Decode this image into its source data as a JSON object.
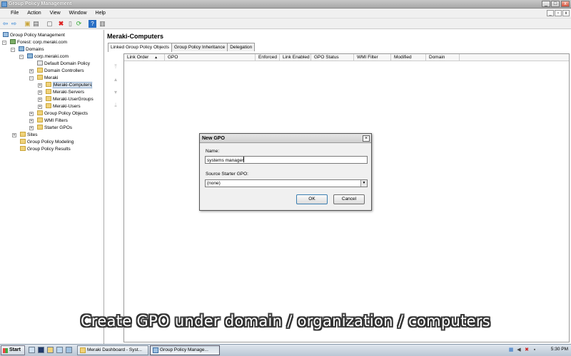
{
  "window": {
    "title": "Group Policy Management"
  },
  "menu": [
    "File",
    "Action",
    "View",
    "Window",
    "Help"
  ],
  "toolbar": {
    "buttons": [
      "back-icon",
      "forward-icon",
      "up-icon",
      "show-hide-tree-icon",
      "properties-icon",
      "delete-icon",
      "export-icon",
      "refresh-icon",
      "help-icon",
      "console-icon"
    ]
  },
  "tree": {
    "root": "Group Policy Management",
    "forest": "Forest: corp.meraki.com",
    "domains": "Domains",
    "domain": "corp.meraki.com",
    "default_policy": "Default Domain Policy",
    "domain_controllers": "Domain Controllers",
    "meraki": "Meraki",
    "meraki_computers": "Meraki-Computers",
    "meraki_servers": "Meraki-Servers",
    "meraki_usergroups": "Meraki-UserGroups",
    "meraki_users": "Meraki-Users",
    "gpo_objects": "Group Policy Objects",
    "wmi_filters": "WMI Filters",
    "starter_gpos": "Starter GPOs",
    "sites": "Sites",
    "modeling": "Group Policy Modeling",
    "results": "Group Policy Results"
  },
  "right": {
    "heading": "Meraki-Computers",
    "tabs": [
      "Linked Group Policy Objects",
      "Group Policy Inheritance",
      "Delegation"
    ],
    "columns": [
      "Link Order",
      "GPO",
      "Enforced",
      "Link Enabled",
      "GPO Status",
      "WMI Filter",
      "Modified",
      "Domain"
    ],
    "sort_glyph": "▲"
  },
  "dialog": {
    "title": "New GPO",
    "name_label": "Name:",
    "name_value": "systems manager",
    "starter_label": "Source Starter GPO:",
    "starter_value": "(none)",
    "ok_label": "OK",
    "cancel_label": "Cancel"
  },
  "caption": "Create GPO under domain / organization / computers",
  "taskbar": {
    "start_label": "Start",
    "tasks": [
      "Meraki Dashboard - Syst...",
      "Group Policy Manage..."
    ],
    "clock": "5:30 PM"
  }
}
